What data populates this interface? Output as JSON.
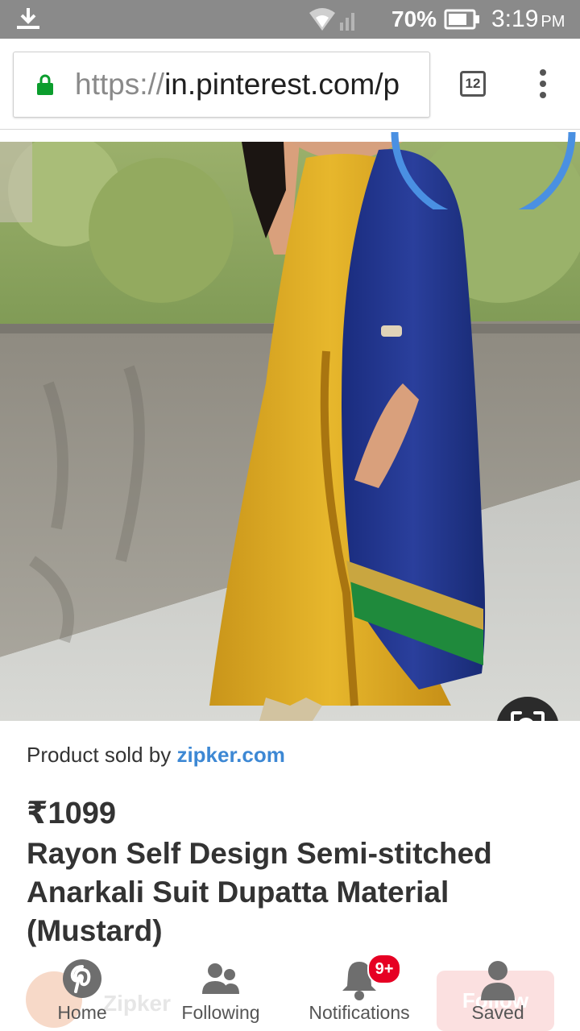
{
  "status_bar": {
    "battery_percent": "70%",
    "time": "3:19",
    "ampm": "PM"
  },
  "browser": {
    "url_scheme": "https://",
    "url_host": "in.pinterest.com/p",
    "tab_count": "12"
  },
  "product": {
    "seller_prefix": "Product sold by ",
    "seller_name": "zipker.com",
    "price": "₹1099",
    "title": "Rayon Self Design Semi-stitched Anarkali Suit Dupatta Material (Mustard)"
  },
  "background_row": {
    "user_name": "Zipker",
    "follow_label": "Follow"
  },
  "nav": {
    "home": "Home",
    "following": "Following",
    "notifications": "Notifications",
    "notifications_badge": "9+",
    "saved": "Saved"
  },
  "colors": {
    "accent": "#e60023",
    "link": "#3d88d4",
    "statusbar": "#8a8a8a"
  }
}
